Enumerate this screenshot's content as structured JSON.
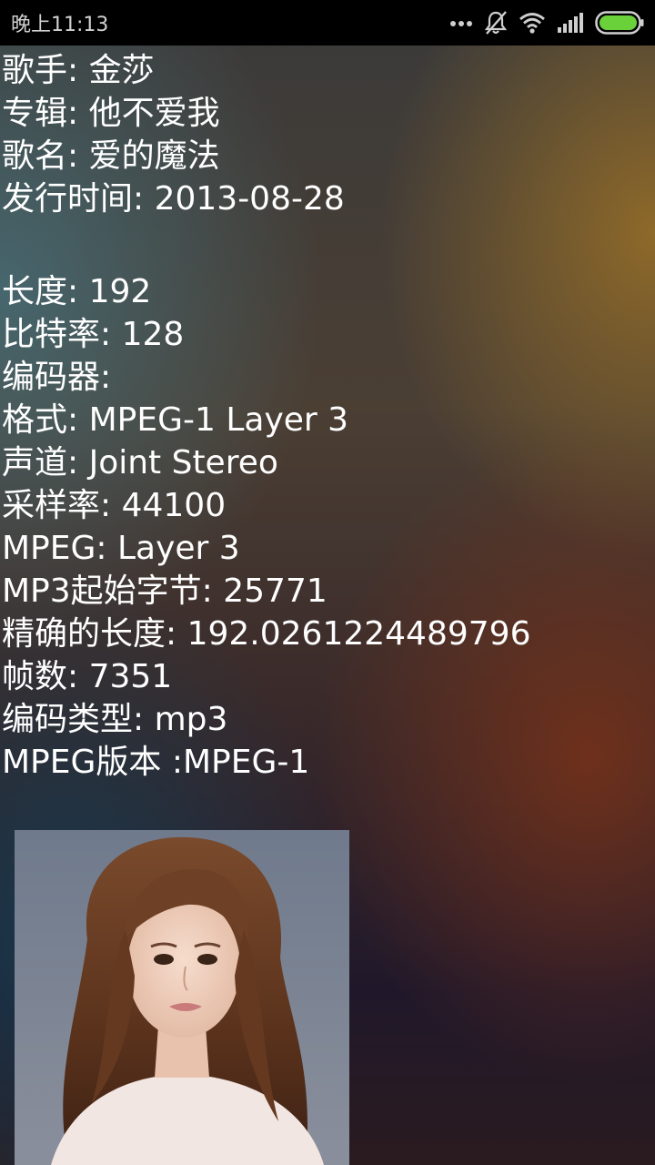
{
  "status_bar": {
    "time": "晚上11:13",
    "icons": [
      "more-dots-icon",
      "mute-bell-icon",
      "wifi-icon",
      "signal-icon",
      "battery-icon"
    ],
    "battery_color": "#6ad13a"
  },
  "info": {
    "artist": "歌手: 金莎",
    "album": "专辑: 他不爱我",
    "song": "歌名: 爱的魔法",
    "release_date": "发行时间: 2013-08-28",
    "length": "长度: 192",
    "bitrate": "比特率: 128",
    "encoder": "编码器:",
    "format": "格式: MPEG-1 Layer 3",
    "channel": "声道: Joint Stereo",
    "sample_rate": "采样率: 44100",
    "mpeg": "MPEG: Layer 3",
    "mp3_start_byte": "MP3起始字节: 25771",
    "precise_length": "精确的长度: 192.0261224489796",
    "frames": "帧数: 7351",
    "encoding_type": "编码类型: mp3",
    "mpeg_version": "MPEG版本 :MPEG-1"
  },
  "album_art": {
    "description_icon": "album-cover-portrait"
  }
}
